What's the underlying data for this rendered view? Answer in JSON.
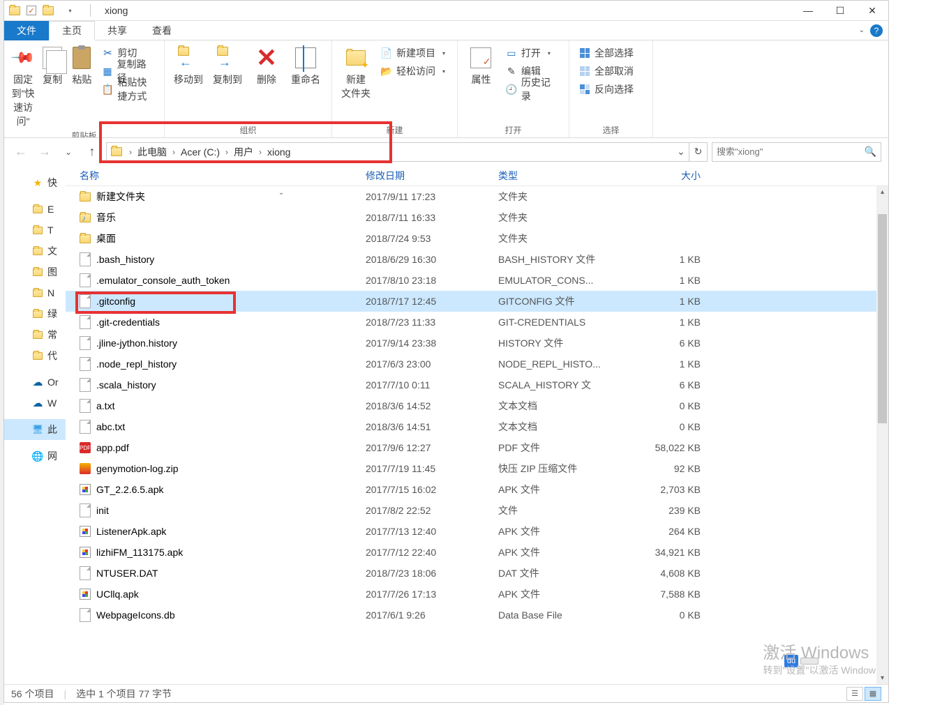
{
  "title": "xiong",
  "win_controls": {
    "min": "—",
    "max": "☐",
    "close": "✕",
    "qa_drop": "▾",
    "help_drop": "⌄"
  },
  "tabs": {
    "file": "文件",
    "home": "主页",
    "share": "共享",
    "view": "查看"
  },
  "ribbon": {
    "pin": "固定到\"快\n速访问\"",
    "copy": "复制",
    "paste": "粘贴",
    "cut": "剪切",
    "copypath": "复制路径",
    "pastelink": "粘贴快捷方式",
    "clipboard_label": "剪贴板",
    "moveto": "移动到",
    "copyto": "复制到",
    "delete": "删除",
    "rename": "重命名",
    "organize_label": "组织",
    "newfolder": "新建\n文件夹",
    "newitem": "新建项目",
    "easyaccess": "轻松访问",
    "new_label": "新建",
    "properties": "属性",
    "open": "打开",
    "edit": "编辑",
    "history": "历史记录",
    "open_label": "打开",
    "selectall": "全部选择",
    "selectnone": "全部取消",
    "invert": "反向选择",
    "select_label": "选择"
  },
  "breadcrumb": [
    "此电脑",
    "Acer (C:)",
    "用户",
    "xiong"
  ],
  "search_placeholder": "搜索\"xiong\"",
  "columns": {
    "name": "名称",
    "date": "修改日期",
    "type": "类型",
    "size": "大小"
  },
  "files": [
    {
      "ic": "fold",
      "name": "新建文件夹",
      "date": "2017/9/11 17:23",
      "type": "文件夹",
      "size": ""
    },
    {
      "ic": "mus",
      "name": "音乐",
      "date": "2018/7/11 16:33",
      "type": "文件夹",
      "size": ""
    },
    {
      "ic": "fold",
      "name": "桌面",
      "date": "2018/7/24 9:53",
      "type": "文件夹",
      "size": ""
    },
    {
      "ic": "doc",
      "name": ".bash_history",
      "date": "2018/6/29 16:30",
      "type": "BASH_HISTORY 文件",
      "size": "1 KB"
    },
    {
      "ic": "doc",
      "name": ".emulator_console_auth_token",
      "date": "2017/8/10 23:18",
      "type": "EMULATOR_CONS...",
      "size": "1 KB"
    },
    {
      "ic": "doc",
      "name": ".gitconfig",
      "date": "2018/7/17 12:45",
      "type": "GITCONFIG 文件",
      "size": "1 KB",
      "sel": true
    },
    {
      "ic": "doc",
      "name": ".git-credentials",
      "date": "2018/7/23 11:33",
      "type": "GIT-CREDENTIALS",
      "size": "1 KB"
    },
    {
      "ic": "doc",
      "name": ".jline-jython.history",
      "date": "2017/9/14 23:38",
      "type": "HISTORY 文件",
      "size": "6 KB"
    },
    {
      "ic": "doc",
      "name": ".node_repl_history",
      "date": "2017/6/3 23:00",
      "type": "NODE_REPL_HISTO...",
      "size": "1 KB"
    },
    {
      "ic": "doc",
      "name": ".scala_history",
      "date": "2017/7/10 0:11",
      "type": "SCALA_HISTORY 文",
      "size": "6 KB"
    },
    {
      "ic": "doc",
      "name": "a.txt",
      "date": "2018/3/6 14:52",
      "type": "文本文档",
      "size": "0 KB"
    },
    {
      "ic": "doc",
      "name": "abc.txt",
      "date": "2018/3/6 14:51",
      "type": "文本文档",
      "size": "0 KB"
    },
    {
      "ic": "pdf",
      "name": "app.pdf",
      "date": "2017/9/6 12:27",
      "type": "PDF 文件",
      "size": "58,022 KB"
    },
    {
      "ic": "zip",
      "name": "genymotion-log.zip",
      "date": "2017/7/19 11:45",
      "type": "快压 ZIP 压缩文件",
      "size": "92 KB"
    },
    {
      "ic": "apk",
      "name": "GT_2.2.6.5.apk",
      "date": "2017/7/15 16:02",
      "type": "APK 文件",
      "size": "2,703 KB"
    },
    {
      "ic": "doc",
      "name": "init",
      "date": "2017/8/2 22:52",
      "type": "文件",
      "size": "239 KB"
    },
    {
      "ic": "apk",
      "name": "ListenerApk.apk",
      "date": "2017/7/13 12:40",
      "type": "APK 文件",
      "size": "264 KB"
    },
    {
      "ic": "apk",
      "name": "lizhiFM_113175.apk",
      "date": "2017/7/12 22:40",
      "type": "APK 文件",
      "size": "34,921 KB"
    },
    {
      "ic": "doc",
      "name": "NTUSER.DAT",
      "date": "2018/7/23 18:06",
      "type": "DAT 文件",
      "size": "4,608 KB"
    },
    {
      "ic": "apk",
      "name": "UCllq.apk",
      "date": "2017/7/26 17:13",
      "type": "APK 文件",
      "size": "7,588 KB"
    },
    {
      "ic": "doc",
      "name": "WebpageIcons.db",
      "date": "2017/6/1 9:26",
      "type": "Data Base File",
      "size": "0 KB"
    }
  ],
  "sidebar": [
    {
      "ic": "star",
      "label": "快"
    },
    {
      "ic": "fold",
      "label": "E"
    },
    {
      "ic": "fold",
      "label": "T"
    },
    {
      "ic": "fold",
      "label": "文"
    },
    {
      "ic": "fold",
      "label": "图"
    },
    {
      "ic": "fold",
      "label": "N"
    },
    {
      "ic": "fold",
      "label": "绿"
    },
    {
      "ic": "fold",
      "label": "常"
    },
    {
      "ic": "fold",
      "label": "代"
    },
    {
      "ic": "od",
      "label": "Or"
    },
    {
      "ic": "od",
      "label": "W"
    },
    {
      "ic": "mon",
      "label": "此",
      "sel": true
    },
    {
      "ic": "globe",
      "label": "网"
    }
  ],
  "status": {
    "items": "56 个项目",
    "selected": "选中 1 个项目 77 字节"
  },
  "watermark": {
    "l1": "激活 Windows",
    "l2": "转到\"设置\"以激活 Window"
  },
  "badge": "du"
}
